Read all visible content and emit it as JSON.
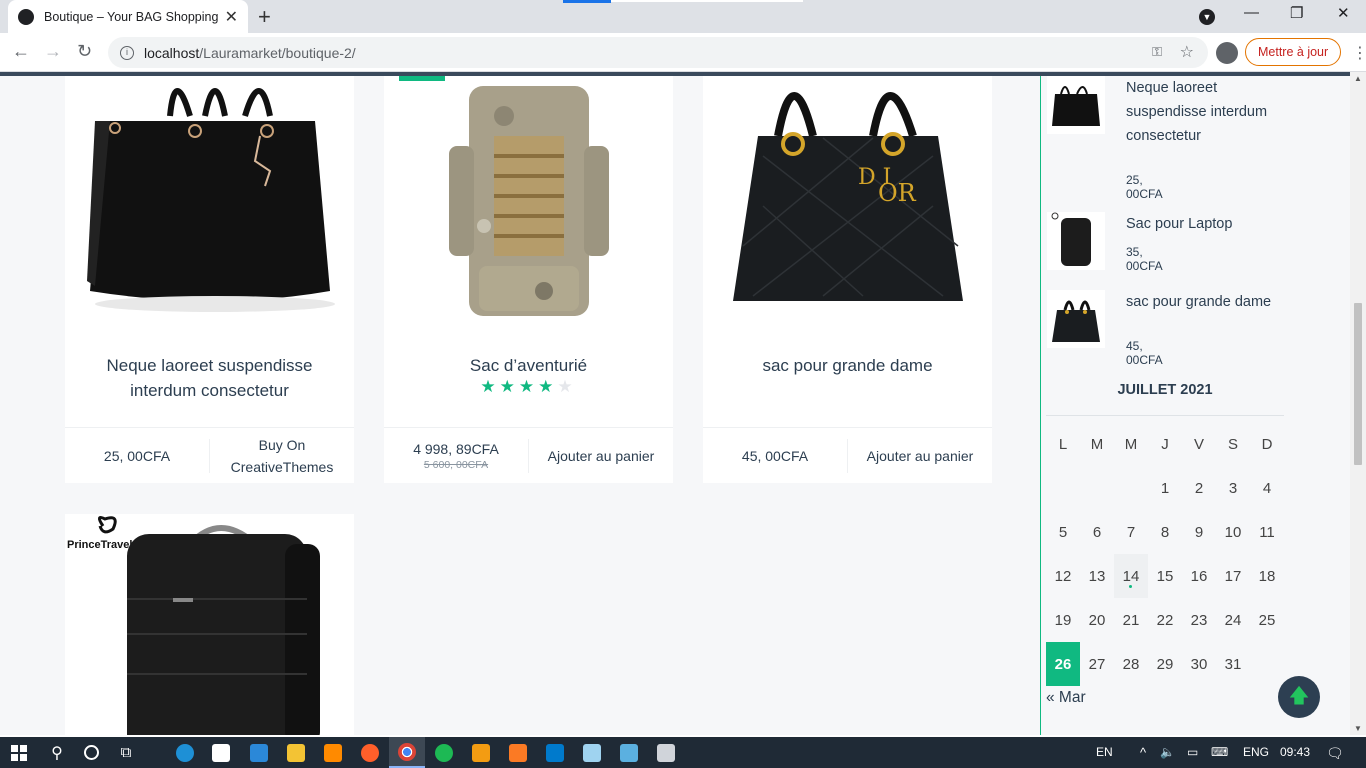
{
  "browser": {
    "tab_title": "Boutique – Your BAG Shopping",
    "url_host": "localhost",
    "url_path": "/Lauramarket/boutique-2/",
    "update_button": "Mettre à jour"
  },
  "products": [
    {
      "title_line1": "Neque laoreet suspendisse",
      "title_line2": "interdum consectetur",
      "price": "25, 00CFA",
      "action_line1": "Buy On",
      "action_line2": "CreativeThemes"
    },
    {
      "title_line1": "Sac d’aventurié",
      "title_line2": "",
      "rating": 4,
      "rating_max": 5,
      "price": "4 998, 89CFA",
      "old_price": "5 600, 00CFA",
      "action_line1": "Ajouter au panier",
      "action_line2": ""
    },
    {
      "title_line1": "sac pour grande dame",
      "title_line2": "",
      "price": "45, 00CFA",
      "action_line1": "Ajouter au panier",
      "action_line2": ""
    },
    {
      "brand_text": "PrinceTravel"
    }
  ],
  "sidebar": {
    "recent": [
      {
        "name": "Neque laoreet suspendisse interdum consectetur",
        "price": "25, 00CFA"
      },
      {
        "name": "Sac pour Laptop",
        "price": "35, 00CFA"
      },
      {
        "name": "sac pour grande dame",
        "price": "45, 00CFA"
      }
    ],
    "calendar": {
      "caption": "JUILLET 2021",
      "days": [
        "L",
        "M",
        "M",
        "J",
        "V",
        "S",
        "D"
      ],
      "weeks": [
        [
          "",
          "",
          "",
          "1",
          "2",
          "3",
          "4"
        ],
        [
          "5",
          "6",
          "7",
          "8",
          "9",
          "10",
          "11"
        ],
        [
          "12",
          "13",
          "14",
          "15",
          "16",
          "17",
          "18"
        ],
        [
          "19",
          "20",
          "21",
          "22",
          "23",
          "24",
          "25"
        ],
        [
          "26",
          "27",
          "28",
          "29",
          "30",
          "31",
          ""
        ]
      ],
      "today": "14",
      "selected": "26",
      "prev_link": "« Mar"
    }
  },
  "taskbar": {
    "lang": "EN",
    "input": "ENG",
    "time": "09:43"
  },
  "colors": {
    "accent": "#10b981",
    "navy": "#2d3f52",
    "star": "#10b981"
  }
}
